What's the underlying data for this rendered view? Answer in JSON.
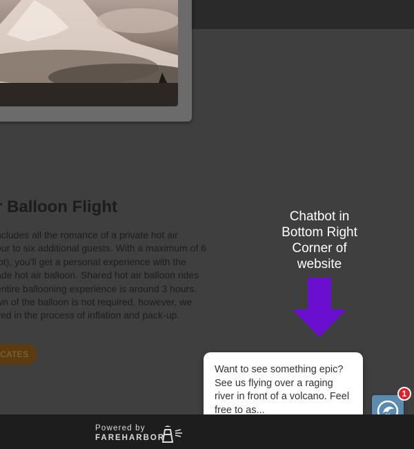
{
  "hero": {
    "image_alt": "Snow-capped volcano above the clouds"
  },
  "content": {
    "title": "r Balloon Flight",
    "description_lines": [
      "ncludes all the romance of a private hot air",
      "our to six additional guests. With a maximum of 6",
      "lot), you'll get a personal experience with the",
      "ade hot air balloon. Shared hot air balloon rides",
      "entire ballooning experience is around 3 hours.",
      "wn of the balloon is not required, however, we",
      "ved in the process of inflation and pack-up."
    ],
    "certificates_button": "CATES"
  },
  "annotation": {
    "text_lines": [
      "Chatbot in",
      "Bottom Right",
      "Corner of",
      "website"
    ],
    "arrow_color": "#6a0fd0"
  },
  "chatbot": {
    "message": "Want to see something epic? See us flying over a raging river in front of a volcano. Feel free to as...",
    "badge_count": "1",
    "launcher_color": "#5b8cb0"
  },
  "footer": {
    "powered_by": "Powered by",
    "brand": "FAREHARBOR"
  }
}
